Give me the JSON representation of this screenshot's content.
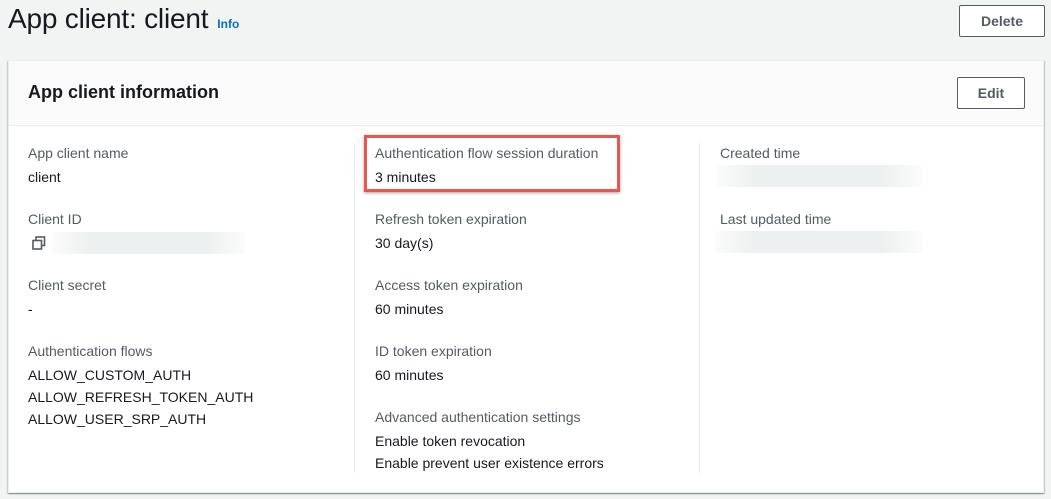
{
  "header": {
    "title": "App client: client",
    "info_label": "Info",
    "delete_label": "Delete"
  },
  "container": {
    "title": "App client information",
    "edit_label": "Edit"
  },
  "column1": {
    "app_client_name_label": "App client name",
    "app_client_name_value": "client",
    "client_id_label": "Client ID",
    "client_secret_label": "Client secret",
    "client_secret_value": "-",
    "auth_flows_label": "Authentication flows",
    "auth_flows": [
      "ALLOW_CUSTOM_AUTH",
      "ALLOW_REFRESH_TOKEN_AUTH",
      "ALLOW_USER_SRP_AUTH"
    ]
  },
  "column2": {
    "auth_session_label": "Authentication flow session duration",
    "auth_session_value": "3 minutes",
    "refresh_label": "Refresh token expiration",
    "refresh_value": "30 day(s)",
    "access_label": "Access token expiration",
    "access_value": "60 minutes",
    "id_label": "ID token expiration",
    "id_value": "60 minutes",
    "advanced_label": "Advanced authentication settings",
    "advanced_values": [
      "Enable token revocation",
      "Enable prevent user existence errors"
    ]
  },
  "column3": {
    "created_label": "Created time",
    "updated_label": "Last updated time"
  },
  "colors": {
    "highlight": "#e8574d",
    "link": "#0073bb",
    "label": "#545b64"
  }
}
